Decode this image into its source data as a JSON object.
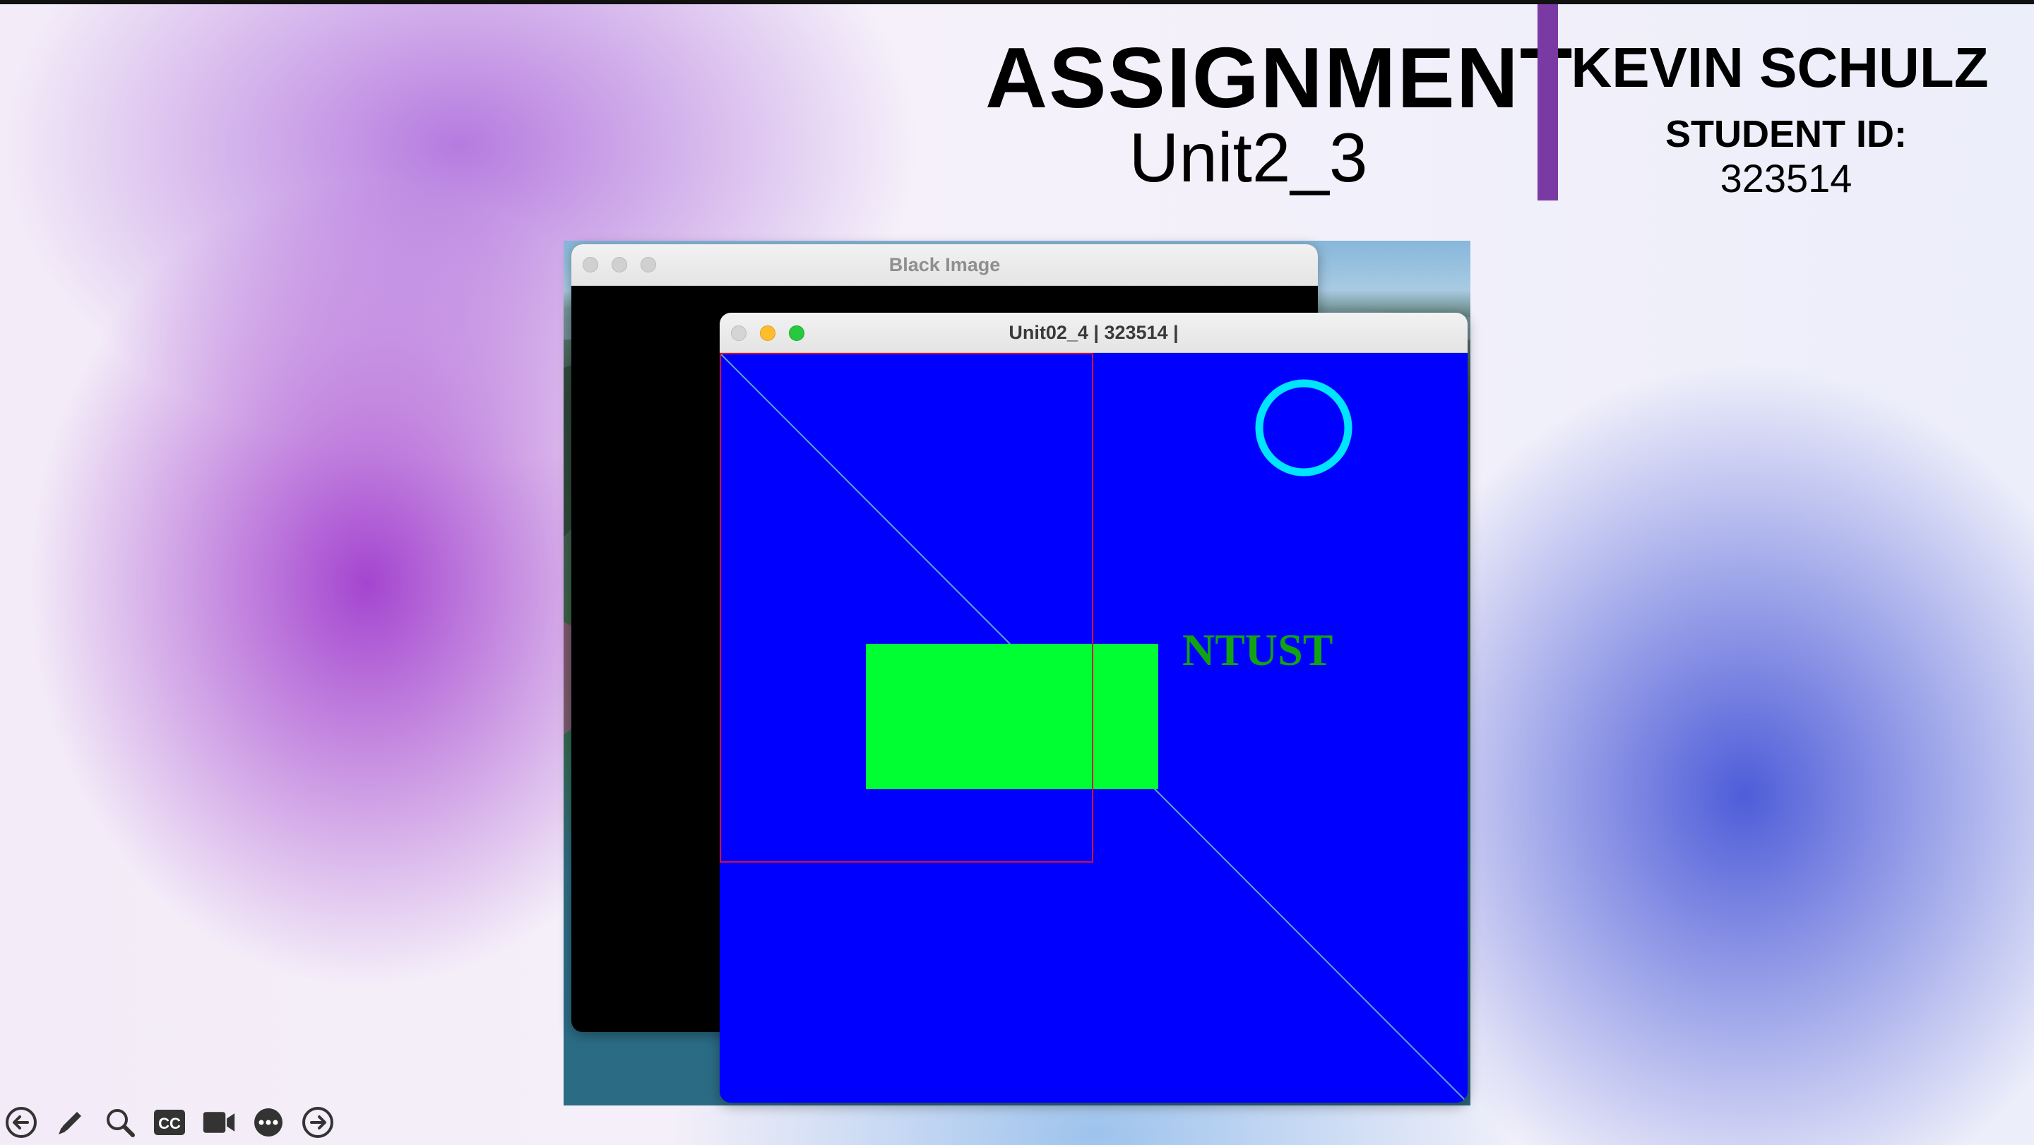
{
  "slide": {
    "title": "ASSIGNMENT",
    "subtitle": "Unit2_3",
    "student_name": "KEVIN SCHULZ",
    "student_id_label": "STUDENT ID:",
    "student_id": "323514"
  },
  "windows": {
    "back": {
      "title": "Black Image",
      "fill": "#000000"
    },
    "front": {
      "title": "Unit02_4 | 323514 |",
      "fill": "#0000ff"
    }
  },
  "canvas": {
    "text": "NTUST",
    "text_color": "#12a312",
    "rectangle_color": "#00ff32",
    "outline_color": "#d0103a",
    "circle_color": "#00e5ff",
    "line_color": "#5aa8c8"
  },
  "toolbar": {
    "icons": [
      "back-arrow-icon",
      "pen-icon",
      "magnifier-icon",
      "cc-icon",
      "video-icon",
      "more-icon",
      "forward-arrow-icon"
    ],
    "cc_label": "CC"
  },
  "colors": {
    "accent_purple": "#7a3aa3",
    "traffic_min": "#febc2e",
    "traffic_max": "#28c840"
  }
}
